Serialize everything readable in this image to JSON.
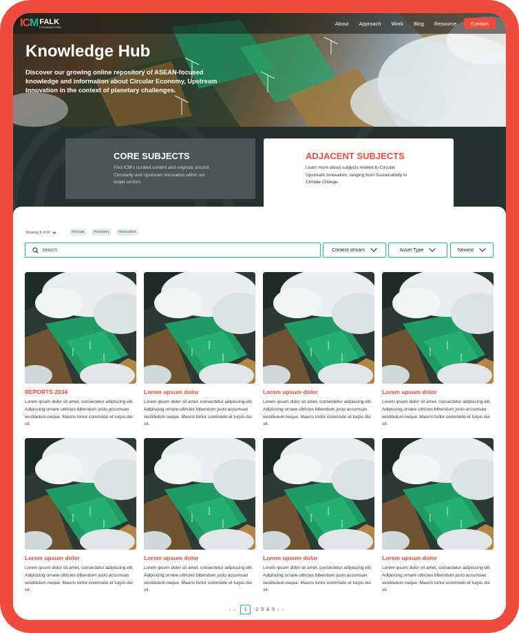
{
  "brand": {
    "mark_left": "IC",
    "mark_right": "M",
    "name": "FALK",
    "tag": "FOUNDATION",
    "accent": "#ee4c3c",
    "teal": "#1fb59a"
  },
  "nav": {
    "items": [
      "About",
      "Approach",
      "Work",
      "Blog",
      "Resource"
    ],
    "contact": "Contact"
  },
  "hero": {
    "title": "Knowledge Hub",
    "description": "Discover our growing online repository of ASEAN-focused knowledge and information about Circular Economy, Upstream Innovation in the context of planetary challenges."
  },
  "subjects": {
    "core": {
      "title": "CORE SUBJECTS",
      "desc": "Find ICM's curated content and originals around Circularity and Upstream Innovation within our target sectors."
    },
    "adjacent": {
      "title": "ADJACENT SUBJECTS",
      "desc": "Learn more about subjects related to Circular Upstream Innovation, ranging from Sustainability to Climate Change."
    }
  },
  "filters": {
    "showing": "Showing 8 of 50",
    "tags": [
      "#circular",
      "#economy",
      "#innovation"
    ],
    "search_placeholder": "Search",
    "dropdowns": [
      "Content stream",
      "Asset Type",
      "Newest"
    ]
  },
  "cards": [
    {
      "title": "REPORTS 2034",
      "body": "Lorem ipsum dolor sit amet, consectetur adipiscing elit. Adipiscing ornare ultricies bibendum justo accumsan vestibulum neque. Mauris tortor commodo et turpis dui sit."
    },
    {
      "title": "Lorem upsum dolor",
      "body": "Lorem ipsum dolor sit amet, consectetur adipiscing elit. Adipiscing ornare ultricies bibendum justo accumsan vestibulum neque. Mauris tortor commodo et turpis dui sit."
    },
    {
      "title": "Lorem upsum dolor",
      "body": "Lorem ipsum dolor sit amet, consectetur adipiscing elit. Adipiscing ornare ultricies bibendum justo accumsan vestibulum neque. Mauris tortor commodo et turpis dui sit."
    },
    {
      "title": "Lorem upsum dolor",
      "body": "Lorem ipsum dolor sit amet, consectetur adipiscing elit. Adipiscing ornare ultricies bibendum justo accumsan vestibulum neque. Mauris tortor commodo et turpis dui sit."
    },
    {
      "title": "Lorem upsum dolor",
      "body": "Lorem ipsum dolor sit amet, consectetur adipiscing elit. Adipiscing ornare ultricies bibendum justo accumsan vestibulum neque. Mauris tortor commodo et turpis dui sit."
    },
    {
      "title": "Lorem upsum dolor",
      "body": "Lorem ipsum dolor sit amet, consectetur adipiscing elit. Adipiscing ornare ultricies bibendum justo accumsan vestibulum neque. Mauris tortor commodo et turpis dui sit."
    },
    {
      "title": "Lorem upsum dolor",
      "body": "Lorem ipsum dolor sit amet, consectetur adipiscing elit. Adipiscing ornare ultricies bibendum justo accumsan vestibulum neque. Mauris tortor commodo et turpis dui sit."
    },
    {
      "title": "Lorem upsum dolor",
      "body": "Lorem ipsum dolor sit amet, consectetur adipiscing elit. Adipiscing ornare ultricies bibendum justo accumsan vestibulum neque. Mauris tortor commodo et turpis dui sit."
    }
  ],
  "pagination": {
    "current": "1",
    "pages": [
      "2",
      "3",
      "4",
      "5"
    ],
    "first": "«",
    "prev": "‹",
    "next": "›",
    "last": "»"
  }
}
